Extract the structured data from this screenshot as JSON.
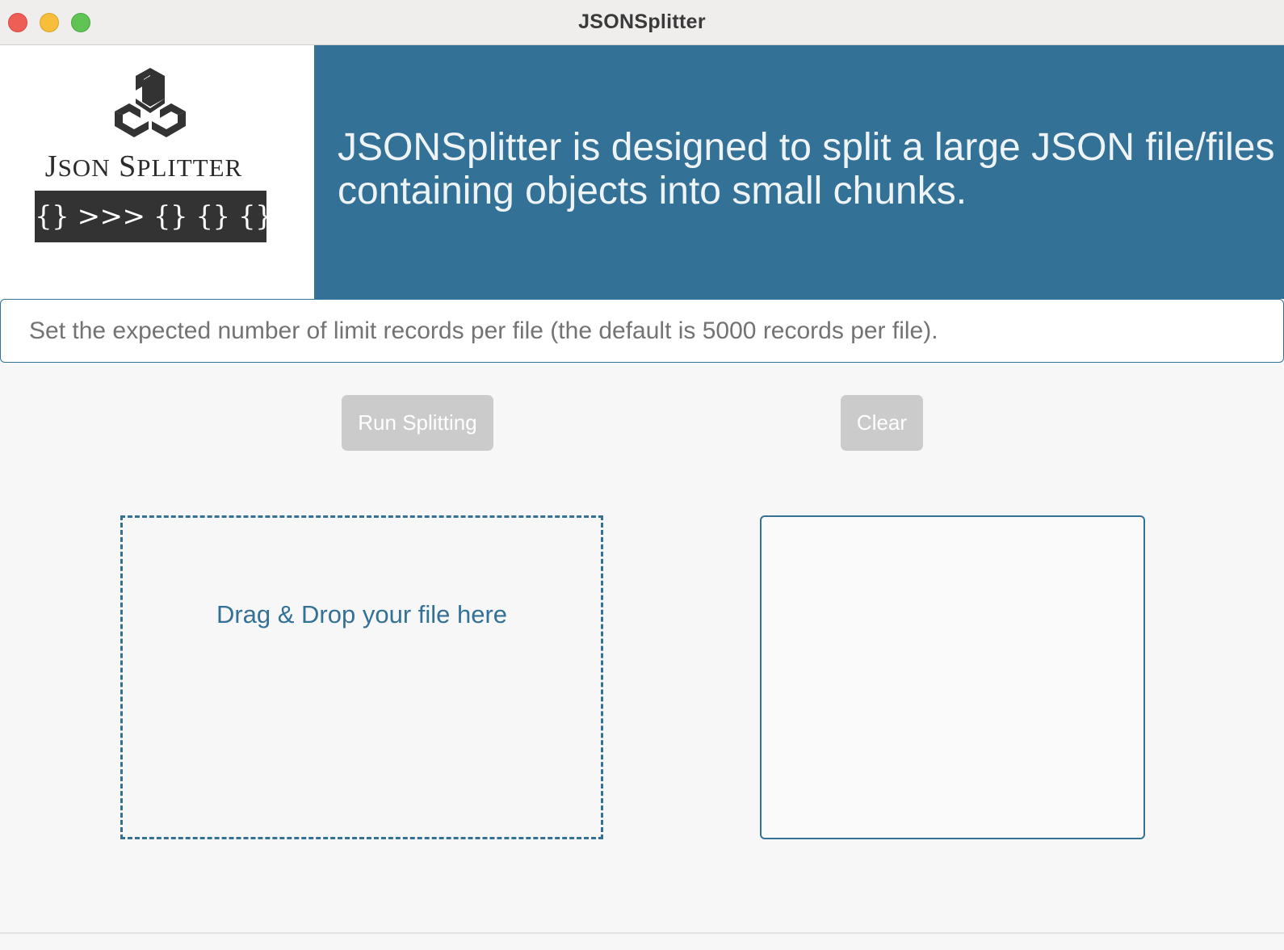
{
  "window": {
    "title": "JSONSplitter"
  },
  "logo": {
    "word_first_initial": "J",
    "word_first_rest": "SON",
    "word_second_initial": "S",
    "word_second_rest": "PLITTER",
    "badge_text": "{} >>> {} {} {} {}"
  },
  "banner": {
    "line1": "JSONSplitter is designed to split a large JSON file/files",
    "line2": "containing objects into small chunks."
  },
  "limit_input": {
    "placeholder": "Set the expected number of limit records per file (the default is 5000 records per file).",
    "value": ""
  },
  "buttons": {
    "run_label": "Run Splitting",
    "clear_label": "Clear"
  },
  "dropzone": {
    "label": "Drag & Drop your file here"
  },
  "output": {
    "value": ""
  },
  "colors": {
    "accent": "#347196",
    "button_disabled": "#cbcbcb",
    "logo_dark": "#333333"
  }
}
